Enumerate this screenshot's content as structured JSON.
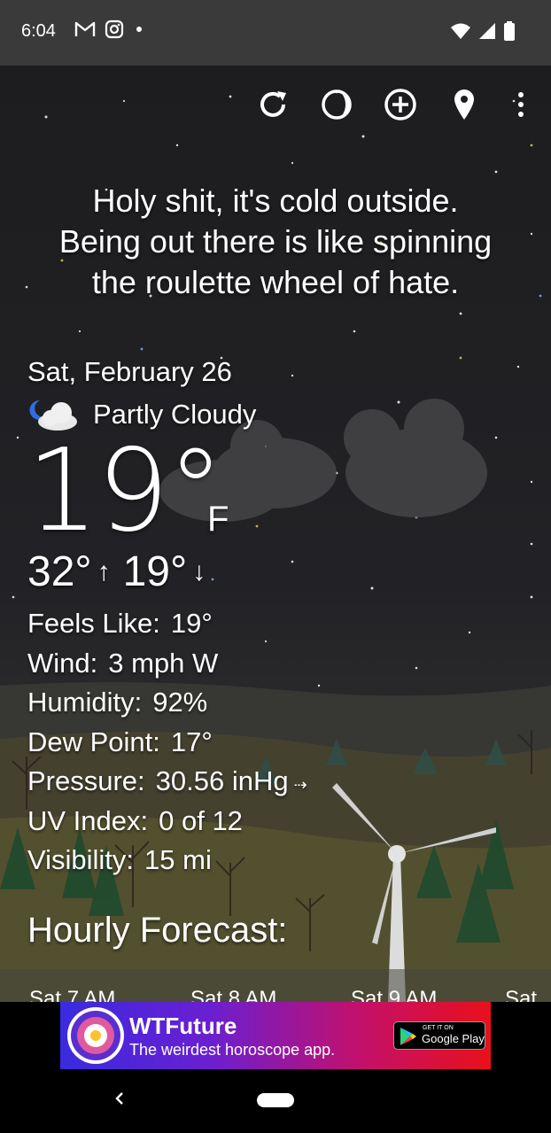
{
  "status_bar": {
    "time": "6:04",
    "left_icons": [
      "gmail-icon",
      "instagram-icon",
      "notification-dot-icon"
    ],
    "right_icons": [
      "wifi-icon",
      "cell-signal-icon",
      "battery-icon"
    ]
  },
  "toolbar": {
    "icons": [
      "refresh-icon",
      "moon-phase-icon",
      "add-location-icon",
      "location-pin-icon",
      "more-vert-icon"
    ]
  },
  "joke": "Holy shit, it's cold outside.\nBeing out there is like spinning\nthe roulette wheel of hate.",
  "current": {
    "date": "Sat, February 26",
    "condition": "Partly Cloudy",
    "condition_icon": "partly-cloudy-night-icon",
    "temperature": "19°",
    "unit": "F",
    "high": "32°",
    "low": "19°"
  },
  "details": [
    {
      "label": "Feels Like:",
      "value": "19°"
    },
    {
      "label": "Wind:",
      "value": "3 mph W"
    },
    {
      "label": "Humidity:",
      "value": "92%"
    },
    {
      "label": "Dew Point:",
      "value": "17°"
    },
    {
      "label": "Pressure:",
      "value": "30.56 inHg"
    },
    {
      "label": "UV Index:",
      "value": "0 of 12"
    },
    {
      "label": "Visibility:",
      "value": "15 mi"
    }
  ],
  "hourly": {
    "title": "Hourly Forecast:",
    "hours": [
      "Sat 7 AM",
      "Sat 8 AM",
      "Sat 9 AM",
      "Sat"
    ]
  },
  "ad": {
    "title": "WTFuture",
    "subtitle": "The weirdest horoscope app.",
    "store_small": "GET IT ON",
    "store_big": "Google Play"
  },
  "colors": {
    "ad_gradient_start": "#3a2ae0",
    "ad_gradient_end": "#e8101a",
    "status_bar": "#3a3a3a"
  }
}
